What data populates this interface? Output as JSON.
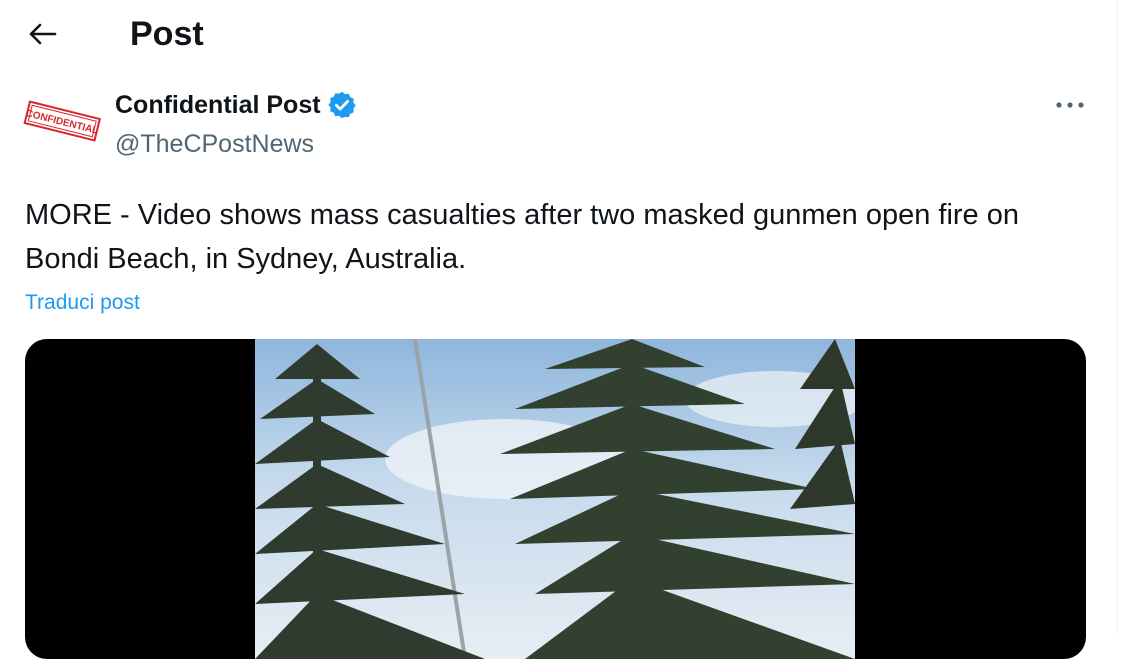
{
  "header": {
    "title": "Post"
  },
  "author": {
    "avatar_text": "CONFIDENTIAL",
    "display_name": "Confidential Post",
    "handle": "@TheCPostNews",
    "verified": true
  },
  "post": {
    "text": "MORE - Video shows mass casualties after two masked gunmen open fire on Bondi Beach, in Sydney, Australia.",
    "translate_label": "Traduci post"
  },
  "media": {
    "kind": "video"
  },
  "icons": {
    "back": "arrow-left-icon",
    "verified": "verified-badge-icon",
    "more": "more-horizontal-icon"
  },
  "colors": {
    "accent": "#1d9bf0",
    "secondary_text": "#536471",
    "text": "#0f1419"
  }
}
